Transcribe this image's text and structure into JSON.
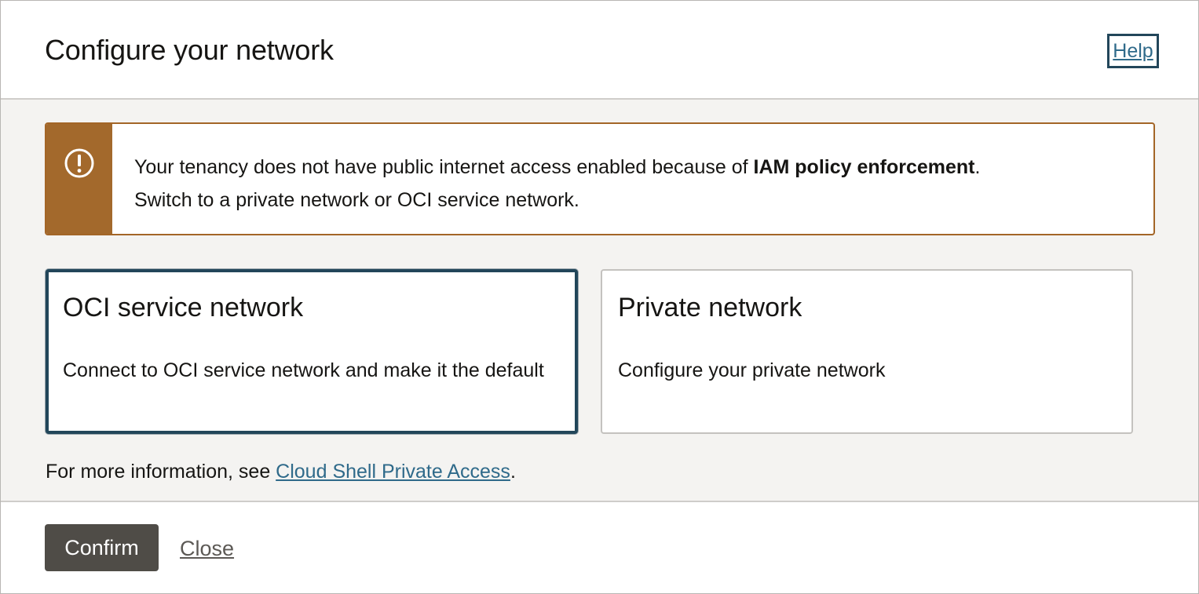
{
  "dialog": {
    "title": "Configure your network",
    "help_label": "Help"
  },
  "alert": {
    "icon": "warning-circle-icon",
    "text_before": "Your tenancy does not have public internet access enabled because of ",
    "text_bold": "IAM policy enforcement",
    "text_after": ".",
    "text_line2": "Switch to a private network or OCI service network.",
    "color": "#a3692c"
  },
  "options": [
    {
      "title": "OCI service network",
      "description": "Connect to OCI service network and make it the default",
      "selected": true
    },
    {
      "title": "Private network",
      "description": "Configure your private network",
      "selected": false
    }
  ],
  "info": {
    "prefix": "For more information, see ",
    "link_text": "Cloud Shell Private Access",
    "suffix": "."
  },
  "footer": {
    "confirm_label": "Confirm",
    "close_label": "Close"
  },
  "colors": {
    "selected_border": "#22465a",
    "link": "#2f6a8a",
    "primary_button": "#4f4c47",
    "body_background": "#f4f3f1"
  }
}
